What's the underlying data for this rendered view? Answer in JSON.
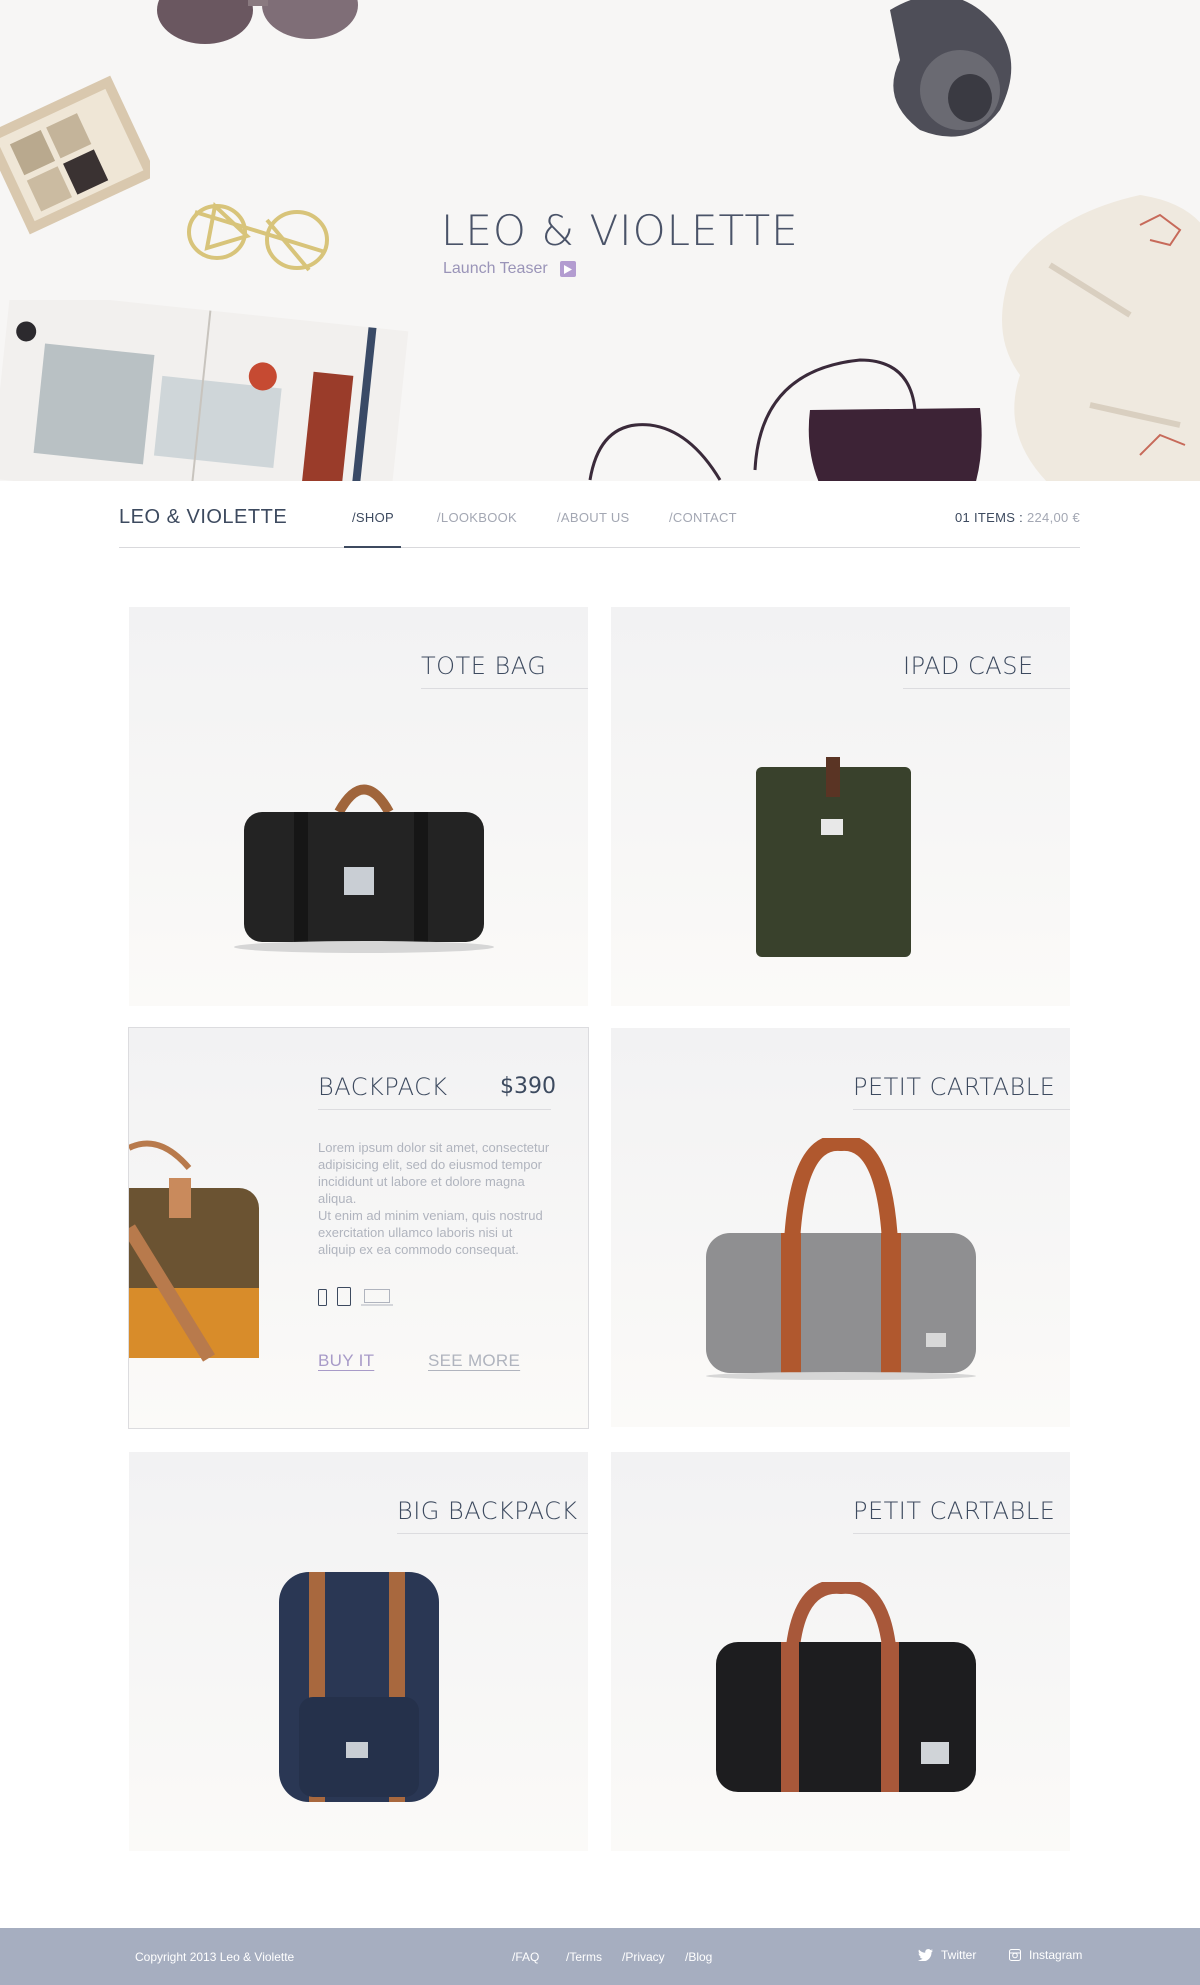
{
  "hero": {
    "title": "LEO & VIOLETTE",
    "subtitle": "Launch Teaser",
    "play_icon": "play-icon"
  },
  "nav": {
    "brand": "LEO & VIOLETTE",
    "links": [
      "/SHOP",
      "/LOOKBOOK",
      "/ABOUT US",
      "/CONTACT"
    ],
    "active": "/SHOP",
    "cart_count": "01 ITEMS :",
    "cart_price": "224,00 €"
  },
  "products": [
    {
      "title": "TOTE BAG",
      "image": "black-duffel-bag"
    },
    {
      "title": "IPAD CASE",
      "image": "green-ipad-sleeve"
    },
    {
      "title": "BACKPACK",
      "price": "$390",
      "image": "brown-doctor-bag",
      "description_1": "Lorem ipsum dolor sit amet, consectetur adipisicing elit, sed do eiusmod tempor incididunt ut labore et dolore magna aliqua.",
      "description_2": "Ut enim ad minim veniam, quis nostrud exercitation ullamco laboris nisi ut aliquip ex ea commodo consequat.",
      "devices": [
        "phone-icon",
        "tablet-icon",
        "laptop-icon"
      ],
      "buy_label": "BUY IT",
      "more_label": "SEE MORE"
    },
    {
      "title": "PETIT CARTABLE",
      "image": "grey-duffel-bag"
    },
    {
      "title": "BIG BACKPACK",
      "image": "navy-backpack"
    },
    {
      "title": "PETIT CARTABLE",
      "image": "black-duffel-tan-straps"
    }
  ],
  "footer": {
    "copyright": "Copyright 2013 Leo & Violette",
    "links": [
      "/FAQ",
      "/Terms",
      "/Privacy",
      "/Blog"
    ],
    "twitter": "Twitter",
    "instagram": "Instagram"
  },
  "colors": {
    "accent": "#a89bc8",
    "text": "#3d4a5f",
    "muted": "#a3a7b3",
    "footer_bg": "#a6aec0"
  }
}
